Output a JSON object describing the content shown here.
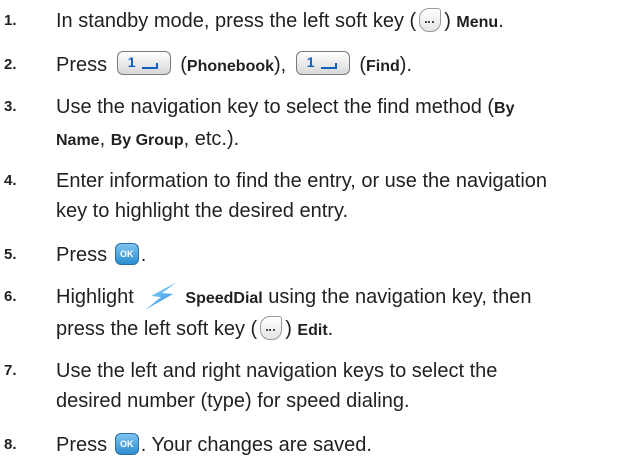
{
  "steps": [
    {
      "number": "1.",
      "t1": "In standby mode, press the left soft key (",
      "t2": ") ",
      "b1": "Menu",
      "t3": "."
    },
    {
      "number": "2.",
      "t1": "Press ",
      "key_label": "1",
      "t2": " (",
      "b1": "Phonebook",
      "t3": "), ",
      "t4": " (",
      "b2": "Find",
      "t5": ")."
    },
    {
      "number": "3.",
      "t1": "Use the navigation key to select the find method (",
      "b1": "By",
      "b2": "Name",
      "t2": ", ",
      "b3": "By Group",
      "t3": ", etc.)."
    },
    {
      "number": "4.",
      "line1": "Enter information to find the entry, or use the navigation",
      "line2": "key to highlight the desired entry."
    },
    {
      "number": "5.",
      "t1": "Press ",
      "ok_label": "OK",
      "t2": "."
    },
    {
      "number": "6.",
      "t1": "Highlight ",
      "b1": "SpeedDial",
      "t2": " using the navigation key, then",
      "t3": "press the left soft key (",
      "t4": ") ",
      "b2": "Edit",
      "t5": "."
    },
    {
      "number": "7.",
      "line1": "Use the left and right navigation keys to select the",
      "line2": "desired number (type) for speed dialing."
    },
    {
      "number": "8.",
      "t1": "Press ",
      "ok_label": "OK",
      "t2": ". Your changes are saved."
    }
  ]
}
